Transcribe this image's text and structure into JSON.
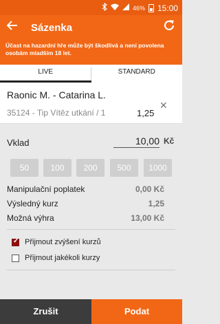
{
  "status_bar": {
    "battery_text": "46%",
    "time": "15:00",
    "icons": [
      "bluetooth-icon",
      "wifi-icon",
      "signal-icon",
      "battery-icon"
    ]
  },
  "app_bar": {
    "title": "Sázenka",
    "back_icon": "arrow-left-icon",
    "refresh_icon": "refresh-icon"
  },
  "notice": "Účast na hazardní hře může být škodlivá a není povolena osobám mladším 18 let.",
  "tabs": [
    {
      "label": "LIVE",
      "active": true
    },
    {
      "label": "STANDARD",
      "active": false
    }
  ],
  "bet": {
    "match": "Raonic M. - Catarina L.",
    "type": "35124 - Tip Vítěz utkání / 1",
    "odds": "1,25"
  },
  "stake": {
    "label": "Vklad",
    "value": "10,00",
    "currency": "Kč"
  },
  "chips": [
    "50",
    "100",
    "200",
    "500",
    "1000"
  ],
  "summary": {
    "fee_label": "Manipulační poplatek",
    "fee_value": "0,00 Kč",
    "total_odds_label": "Výsledný kurz",
    "total_odds_value": "1,25",
    "win_label": "Možná výhra",
    "win_value": "13,00 Kč"
  },
  "options": [
    {
      "label": "Přijmout zvýšení kurzů",
      "checked": true
    },
    {
      "label": "Přijmout jakékoli kurzy",
      "checked": false
    }
  ],
  "actions": {
    "cancel": "Zrušit",
    "submit": "Podat"
  },
  "colors": {
    "accent": "#f26716",
    "dark": "#3c3c3c",
    "checkbox": "#8b1010"
  }
}
